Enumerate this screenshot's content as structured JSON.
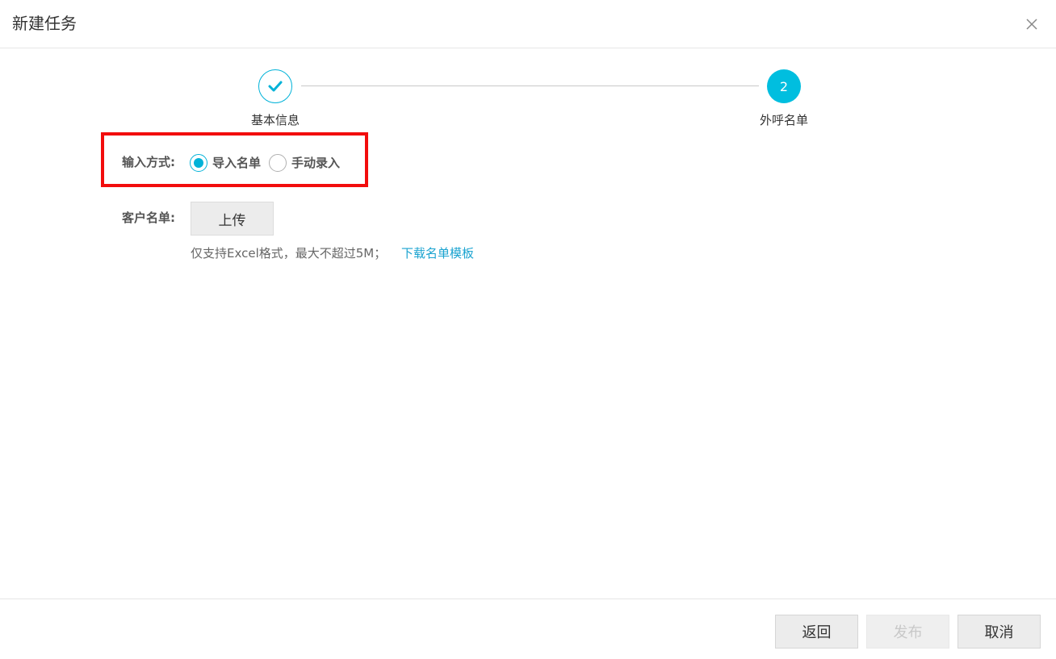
{
  "dialog": {
    "title": "新建任务",
    "close_icon": "close-icon"
  },
  "steps": [
    {
      "label": "基本信息",
      "status": "done",
      "icon": "check-icon"
    },
    {
      "label": "外呼名单",
      "number": "2",
      "status": "active"
    }
  ],
  "form": {
    "input_method": {
      "label": "输入方式:",
      "options": [
        {
          "label": "导入名单",
          "checked": true
        },
        {
          "label": "手动录入",
          "checked": false
        }
      ]
    },
    "customer_list": {
      "label": "客户名单:",
      "upload_label": "上传",
      "hint": "仅支持Excel格式，最大不超过5M；",
      "download_link": "下载名单模板"
    }
  },
  "footer": {
    "back_label": "返回",
    "publish_label": "发布",
    "cancel_label": "取消"
  },
  "colors": {
    "accent": "#00bedf",
    "link": "#1aa3d0",
    "highlight": "#f20d0d"
  }
}
